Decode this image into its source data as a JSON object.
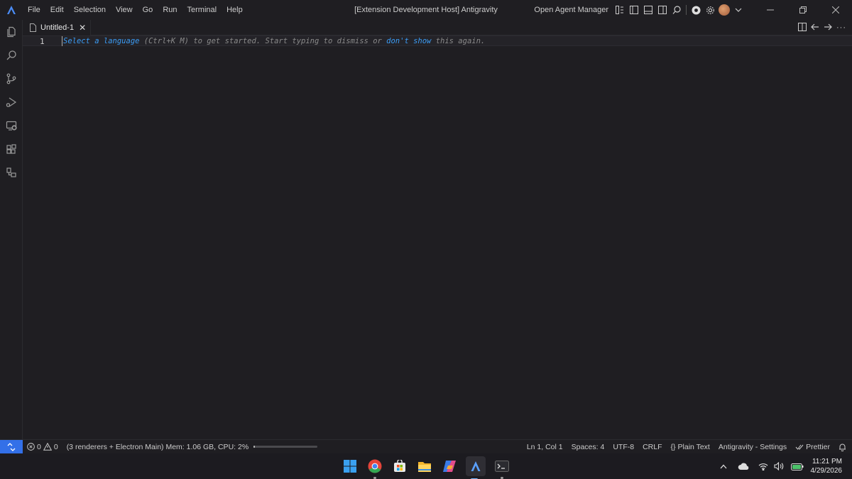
{
  "titlebar": {
    "menu": [
      "File",
      "Edit",
      "Selection",
      "View",
      "Go",
      "Run",
      "Terminal",
      "Help"
    ],
    "window_title": "[Extension Development Host] Antigravity",
    "agent_manager_label": "Open Agent Manager"
  },
  "activity_bar": {
    "items": [
      "explorer-icon",
      "search-icon",
      "source-control-icon",
      "run-debug-icon",
      "remote-explorer-icon",
      "extensions-icon",
      "agent-panel-icon"
    ]
  },
  "tabs": [
    {
      "label": "Untitled-1",
      "icon": "file-icon",
      "active": true
    }
  ],
  "editor": {
    "line_number": "1",
    "hint": {
      "select_language": "Select a language",
      "shortcut_text": " (Ctrl+K M) to get started. Start typing to dismiss or ",
      "dont_show": "don't show",
      "tail": " this again."
    }
  },
  "statusbar": {
    "errors": "0",
    "warnings": "0",
    "process_info": "(3 renderers + Electron Main) Mem: 1.06 GB, CPU: 2%",
    "cpu_fraction": 0.02,
    "position": "Ln 1, Col 1",
    "spaces": "Spaces: 4",
    "encoding": "UTF-8",
    "eol": "CRLF",
    "language_braces": "{}",
    "language": "Plain Text",
    "settings": "Antigravity - Settings",
    "prettier": "Prettier"
  },
  "taskbar": {
    "apps": [
      "windows-start-icon",
      "chrome-icon",
      "store-icon",
      "file-explorer-icon",
      "copilot-icon",
      "antigravity-icon",
      "terminal-icon"
    ],
    "time": "11:21 PM",
    "date": "4/29/2026"
  },
  "colors": {
    "accent": "#3370e8",
    "link": "#3b9cf5",
    "background": "#1f1e22"
  }
}
